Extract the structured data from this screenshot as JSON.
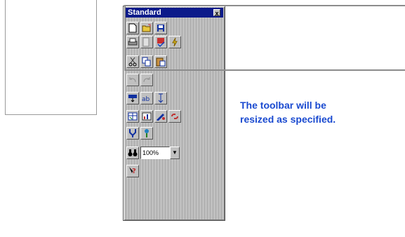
{
  "toolbar": {
    "title": "Standard",
    "close_glyph": "x",
    "zoom_value": "100%",
    "zoom_arrow": "▼"
  },
  "icons": {
    "new": "new-document-icon",
    "open": "open-folder-icon",
    "save": "save-icon",
    "print": "print-icon",
    "preview": "print-preview-icon",
    "spell": "spell-check-icon",
    "lightning": "lightning-icon",
    "cut": "cut-icon",
    "copy": "copy-icon",
    "paste": "paste-icon",
    "undo": "undo-icon",
    "redo": "redo-icon",
    "insert": "insert-icon",
    "autotext": "autotext-icon",
    "sort": "sort-icon",
    "drawing": "drawing-icon",
    "zoom": "zoom-icon",
    "help": "help-icon"
  },
  "message": {
    "line1": "The toolbar will be",
    "line2": "resized as specified."
  },
  "colors": {
    "title_bar": "#0c1a8a",
    "message_text": "#1a4ad0",
    "toolbar_bg": "#c0c0c0"
  }
}
